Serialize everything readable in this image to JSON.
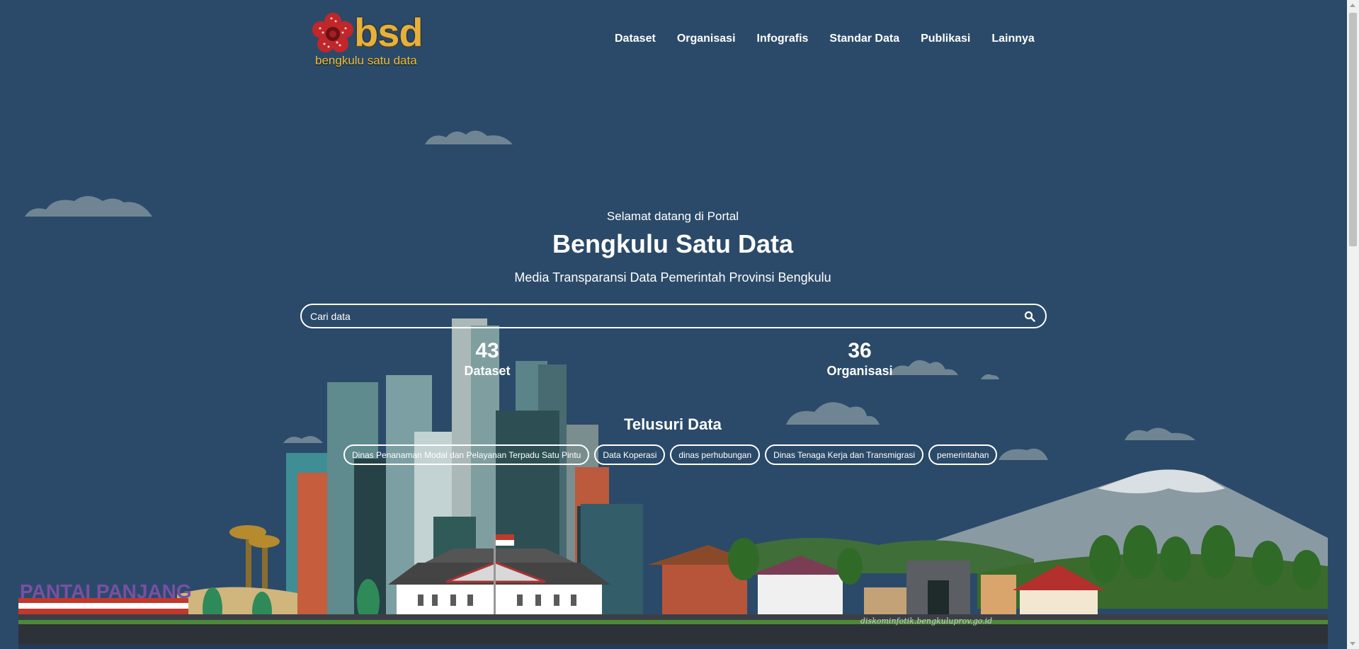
{
  "logo": {
    "text": "bsd",
    "subtitle": "bengkulu satu data"
  },
  "nav": [
    "Dataset",
    "Organisasi",
    "Infografis",
    "Standar Data",
    "Publikasi",
    "Lainnya"
  ],
  "hero": {
    "welcome": "Selamat datang di Portal",
    "title": "Bengkulu Satu Data",
    "subtitle": "Media Transparansi Data Pemerintah Provinsi Bengkulu"
  },
  "search": {
    "placeholder": "Cari data"
  },
  "stats": [
    {
      "value": "43",
      "label": "Dataset"
    },
    {
      "value": "36",
      "label": "Organisasi"
    }
  ],
  "explore": {
    "title": "Telusuri Data",
    "tags": [
      "Dinas Penanaman Modal dan Pelayanan Terpadu Satu Pintu",
      "Data Koperasi",
      "dinas perhubungan",
      "Dinas Tenaga Kerja dan Transmigrasi",
      "pemerintahan"
    ]
  },
  "illustration": {
    "beach_sign": "PANTAI PANJANG",
    "credit": "diskominfotik.bengkuluprov.go.id"
  },
  "colors": {
    "background": "#2b4a69",
    "logo_gold": "#e7b03a"
  }
}
